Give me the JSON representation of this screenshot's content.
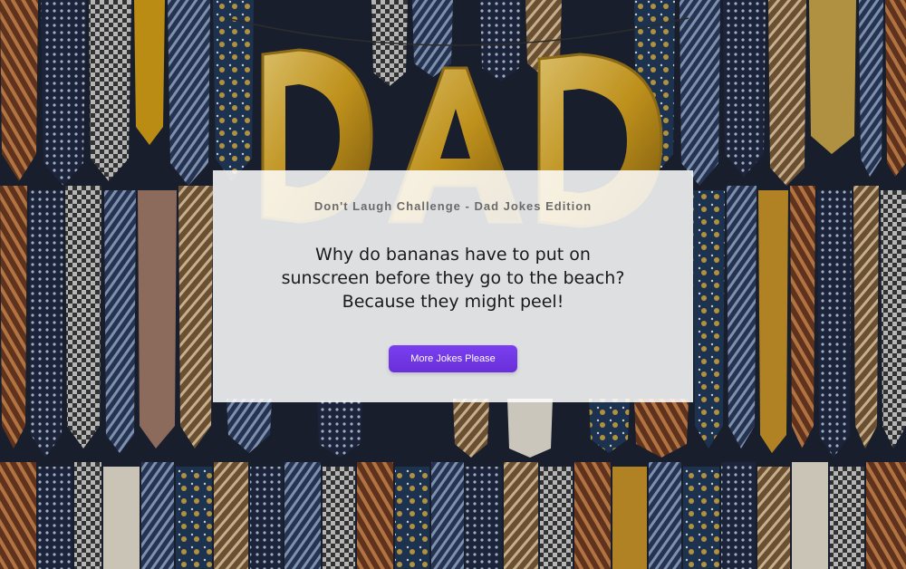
{
  "card": {
    "title": "Don't Laugh Challenge - Dad Jokes Edition",
    "joke_question_line1": "Why do bananas have to put on",
    "joke_question_line2": "sunscreen before they go to the beach?",
    "joke_answer": "Because they might peel!",
    "button_label": "More Jokes Please"
  },
  "background": {
    "balloon_letters": [
      "D",
      "A",
      "D"
    ]
  },
  "colors": {
    "button": "#6a2fd9",
    "balloon_gold": "#d9a520"
  }
}
